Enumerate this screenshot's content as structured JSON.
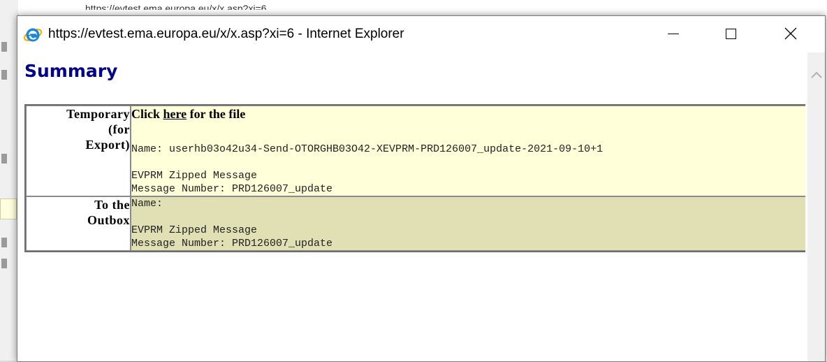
{
  "background": {
    "url_fragment": "https://evtest.ema.europa.eu/x/x.asp?xi=6"
  },
  "window": {
    "title": "https://evtest.ema.europa.eu/x/x.asp?xi=6 - Internet Explorer",
    "icon": "internet-explorer-icon",
    "controls": {
      "minimize": "minimize",
      "maximize": "maximize",
      "close": "close"
    }
  },
  "page": {
    "heading": "Summary",
    "rows": [
      {
        "label_lines": [
          "Temporary",
          "(for",
          "Export)"
        ],
        "click_prefix": "Click ",
        "click_link": "here",
        "click_suffix": " for the file",
        "name_line": "Name: userhb03o42u34-Send-OTORGHB03O42-XEVPRM-PRD126007_update-2021-09-10+1",
        "msg_type": "EVPRM Zipped Message",
        "msg_number": "Message Number: PRD126007_update"
      },
      {
        "label_lines": [
          "To the",
          "Outbox"
        ],
        "name_line": "Name:",
        "msg_type": "EVPRM Zipped Message",
        "msg_number": "Message Number: PRD126007_update"
      }
    ]
  },
  "colors": {
    "heading": "#00008b",
    "row1_bg": "#ffffd9",
    "row2_bg": "#e0e0b4",
    "ie_blue": "#1e88d8",
    "ie_ring": "#f2b400"
  }
}
